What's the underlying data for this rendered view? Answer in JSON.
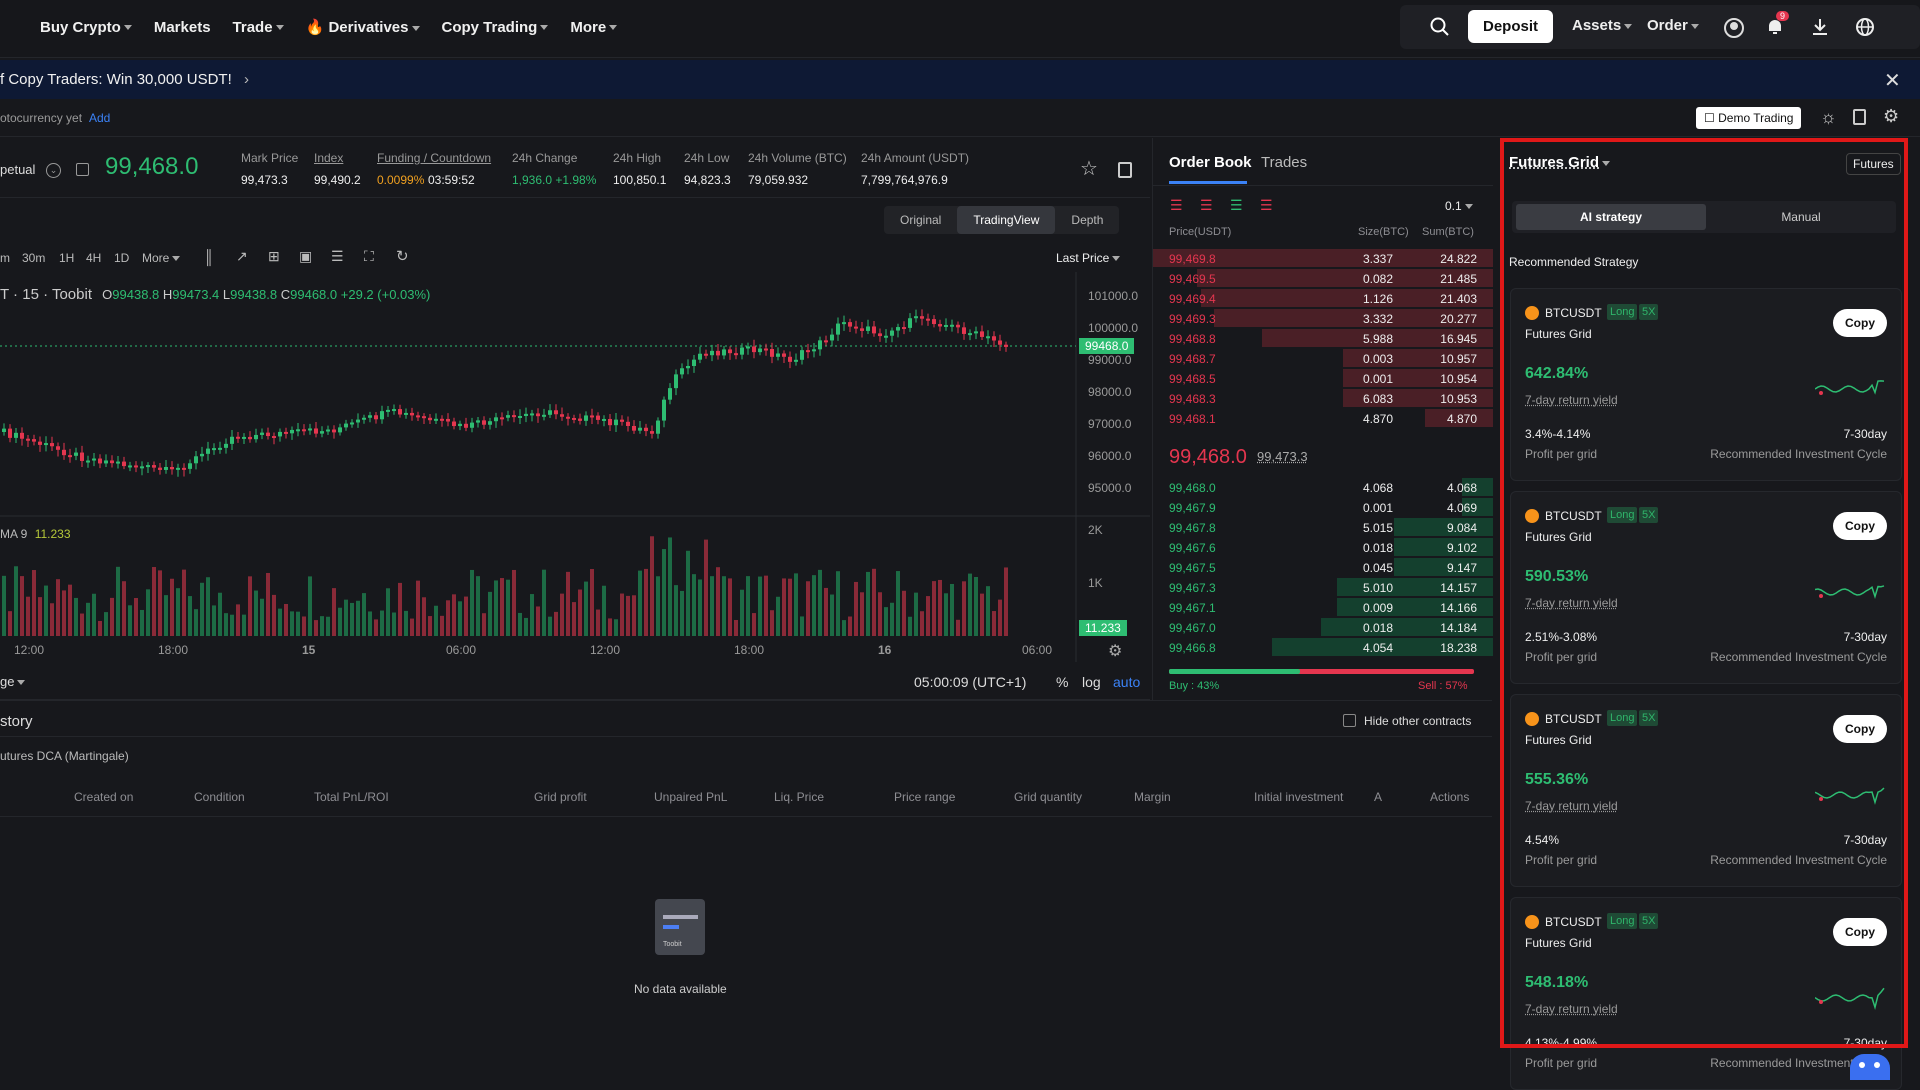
{
  "nav": {
    "items": [
      "Buy Crypto",
      "Markets",
      "Trade",
      "Derivatives",
      "Copy Trading",
      "More"
    ],
    "deposit": "Deposit",
    "assets": "Assets",
    "order": "Order",
    "badge": "9"
  },
  "banner": {
    "text": "f Copy Traders: Win 30,000 USDT!"
  },
  "subbar": {
    "text": "otocurrency yet",
    "add": "Add",
    "demo": "Demo Trading"
  },
  "ticker": {
    "symbol_suffix": "petual",
    "price": "99,468.0",
    "fields": [
      {
        "label": "Mark Price",
        "value": "99,473.3"
      },
      {
        "label": "Index",
        "value": "99,490.2"
      },
      {
        "label": "Funding / Countdown",
        "value": "0.0099%",
        "value2": "03:59:52"
      },
      {
        "label": "24h Change",
        "value": "1,936.0 +1.98%"
      },
      {
        "label": "24h High",
        "value": "100,850.1"
      },
      {
        "label": "24h Low",
        "value": "94,823.3"
      },
      {
        "label": "24h Volume (BTC)",
        "value": "79,059.932"
      },
      {
        "label": "24h Amount (USDT)",
        "value": "7,799,764,976.9"
      }
    ]
  },
  "chart_tabs": [
    "Original",
    "TradingView",
    "Depth"
  ],
  "toolbar": {
    "intervals": [
      "m",
      "30m",
      "1H",
      "4H",
      "1D",
      "More"
    ],
    "last_price": "Last Price"
  },
  "chart_data": {
    "type": "candlestick",
    "legend": "T · 15 · Toobit",
    "ohlc": {
      "O": "99438.8",
      "H": "99473.4",
      "L": "99438.8",
      "C": "99468.0",
      "change": "+29.2 (+0.03%)"
    },
    "y_ticks": [
      "101000.0",
      "100000.0",
      "99000.0",
      "98000.0",
      "97000.0",
      "96000.0",
      "95000.0"
    ],
    "price_tag": "99468.0",
    "vol_ticks": [
      "2K",
      "1K"
    ],
    "vol_tag": "11.233",
    "ma_label": "MA 9",
    "ma_value": "11.233",
    "x_ticks": [
      "12:00",
      "18:00",
      "15",
      "06:00",
      "12:00",
      "18:00",
      "16",
      "06:00"
    ],
    "footer_left": "ge",
    "footer_time": "05:00:09 (UTC+1)",
    "footer_opts": [
      "%",
      "log",
      "auto"
    ]
  },
  "orderbook": {
    "tabs": [
      "Order Book",
      "Trades"
    ],
    "precision": "0.1",
    "headers": [
      "Price(USDT)",
      "Size(BTC)",
      "Sum(BTC)"
    ],
    "asks": [
      {
        "p": "99,469.8",
        "s": "3.337",
        "t": "24.822",
        "d": 1.0
      },
      {
        "p": "99,469.5",
        "s": "0.082",
        "t": "21.485",
        "d": 0.87
      },
      {
        "p": "99,469.4",
        "s": "1.126",
        "t": "21.403",
        "d": 0.86
      },
      {
        "p": "99,469.3",
        "s": "3.332",
        "t": "20.277",
        "d": 0.82
      },
      {
        "p": "99,468.8",
        "s": "5.988",
        "t": "16.945",
        "d": 0.68
      },
      {
        "p": "99,468.7",
        "s": "0.003",
        "t": "10.957",
        "d": 0.44
      },
      {
        "p": "99,468.5",
        "s": "0.001",
        "t": "10.954",
        "d": 0.44
      },
      {
        "p": "99,468.3",
        "s": "6.083",
        "t": "10.953",
        "d": 0.44
      },
      {
        "p": "99,468.1",
        "s": "4.870",
        "t": "4.870",
        "d": 0.2
      }
    ],
    "mid_price": "99,468.0",
    "mid_mark": "99,473.3",
    "bids": [
      {
        "p": "99,468.0",
        "s": "4.068",
        "t": "4.068",
        "d": 0.12
      },
      {
        "p": "99,467.9",
        "s": "0.001",
        "t": "4.069",
        "d": 0.12
      },
      {
        "p": "99,467.8",
        "s": "5.015",
        "t": "9.084",
        "d": 0.38
      },
      {
        "p": "99,467.6",
        "s": "0.018",
        "t": "9.102",
        "d": 0.38
      },
      {
        "p": "99,467.5",
        "s": "0.045",
        "t": "9.147",
        "d": 0.38
      },
      {
        "p": "99,467.3",
        "s": "5.010",
        "t": "14.157",
        "d": 0.6
      },
      {
        "p": "99,467.1",
        "s": "0.009",
        "t": "14.166",
        "d": 0.6
      },
      {
        "p": "99,467.0",
        "s": "0.018",
        "t": "14.184",
        "d": 0.66
      },
      {
        "p": "99,466.8",
        "s": "4.054",
        "t": "18.238",
        "d": 0.85
      }
    ],
    "buy_label": "Buy :",
    "buy_pct": "43%",
    "sell_label": "Sell :",
    "sell_pct": "57%",
    "buy_ratio": 0.43
  },
  "bottom": {
    "title": "story",
    "hide_label": "Hide other contracts",
    "sub_tab": "utures DCA (Martingale)",
    "columns": [
      "Created on",
      "Condition",
      "Total PnL/ROI",
      "Grid profit",
      "Unpaired PnL",
      "Liq. Price",
      "Price range",
      "Grid quantity",
      "Margin",
      "Initial investment",
      "A",
      "Actions"
    ],
    "empty": "No data available",
    "empty_logo": "Toobit"
  },
  "grid": {
    "title": "Futures Grid",
    "futures_btn": "Futures",
    "tabs": [
      "AI strategy",
      "Manual"
    ],
    "section": "Recommended Strategy",
    "cards": [
      {
        "pair": "BTCUSDT",
        "side": "Long",
        "lev": "5X",
        "type": "Futures Grid",
        "yield": "642.84%",
        "yield_label": "7-day return yield",
        "ppg": "3.4%-4.14%",
        "ppg_label": "Profit per grid",
        "cycle": "7-30day",
        "cycle_label": "Recommended Investment Cycle",
        "copy": "Copy"
      },
      {
        "pair": "BTCUSDT",
        "side": "Long",
        "lev": "5X",
        "type": "Futures Grid",
        "yield": "590.53%",
        "yield_label": "7-day return yield",
        "ppg": "2.51%-3.08%",
        "ppg_label": "Profit per grid",
        "cycle": "7-30day",
        "cycle_label": "Recommended Investment Cycle",
        "copy": "Copy"
      },
      {
        "pair": "BTCUSDT",
        "side": "Long",
        "lev": "5X",
        "type": "Futures Grid",
        "yield": "555.36%",
        "yield_label": "7-day return yield",
        "ppg": "4.54%",
        "ppg_label": "Profit per grid",
        "cycle": "7-30day",
        "cycle_label": "Recommended Investment Cycle",
        "copy": "Copy"
      },
      {
        "pair": "BTCUSDT",
        "side": "Long",
        "lev": "5X",
        "type": "Futures Grid",
        "yield": "548.18%",
        "yield_label": "7-day return yield",
        "ppg": "4.13%-4.99%",
        "ppg_label": "Profit per grid",
        "cycle": "7-30day",
        "cycle_label": "Recommended Investment Cycle",
        "copy": "Copy"
      }
    ]
  },
  "colors": {
    "up": "#2ebd72",
    "down": "#e5364f",
    "accent": "#3b82f6",
    "highlight": "#e01818"
  }
}
